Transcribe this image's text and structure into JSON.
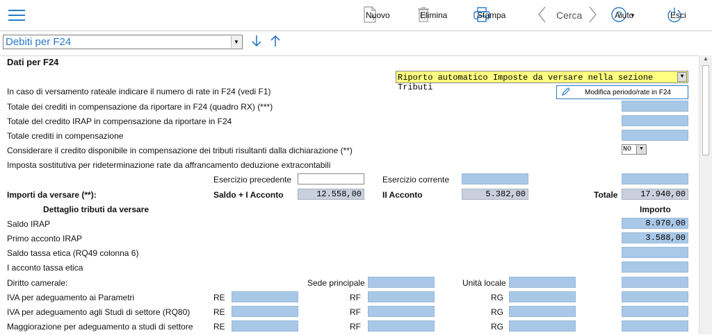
{
  "toolbar": {
    "nuovo": "Nuovo",
    "elimina": "Elimina",
    "stampa": "Stampa",
    "cerca": "Cerca",
    "aiuto": "Aiuto",
    "esci": "Esci"
  },
  "selector": {
    "value": "Debiti per F24"
  },
  "section": {
    "title": "Dati per F24",
    "auto_dropdown": "Riporto automatico Imposte da versare nella sezione Tributi",
    "modifica_button": "Modifica periodo/rate in F24"
  },
  "rows": {
    "rateale": "In caso di versamento rateale indicare il numero di rate in F24 (vedi F1)",
    "crediti_rx": "Totale dei crediti in compensazione da riportare in F24 (quadro RX) (***)",
    "credito_irap": "Totale del credito IRAP in compensazione da riportare in F24",
    "totale_crediti": "Totale crediti in compensazione",
    "considerare": "Considerare il credito disponibile in compensazione dei tributi risultanti dalla dichiarazione (**)",
    "considerare_value": "NO",
    "imposta_sost": "Imposta sostitutiva per rideterminazione rate da affrancamento deduzione extracontabili"
  },
  "importi": {
    "esercizio_precedente": "Esercizio precedente",
    "esercizio_corrente": "Esercizio corrente",
    "label": "Importi da versare (**):",
    "saldo_label": "Saldo + I Acconto",
    "saldo_value": "12.558,00",
    "acconto_label": "II Acconto",
    "acconto_value": "5.382,00",
    "totale_label": "Totale",
    "totale_value": "17.940,00"
  },
  "dettaglio": {
    "header": "Dettaglio tributi da versare",
    "importo_header": "Importo",
    "saldo_irap": "Saldo IRAP",
    "saldo_irap_value": "8.970,00",
    "primo_acconto": "Primo acconto IRAP",
    "primo_acconto_value": "3.588,00",
    "saldo_tassa": "Saldo tassa etica (RQ49 colonna 6)",
    "acconto_tassa": "I acconto tassa etica",
    "diritto_camerale": "Diritto camerale:",
    "sede_principale": "Sede principale",
    "unita_locale": "Unità locale",
    "iva_parametri": "IVA per adeguamento ai Parametri",
    "iva_studi": "IVA per adeguamento agli Studi di settore (RQ80)",
    "maggiorazione": "Maggiorazione per adeguamento a studi di settore",
    "re": "RE",
    "rf": "RF",
    "rg": "RG"
  }
}
